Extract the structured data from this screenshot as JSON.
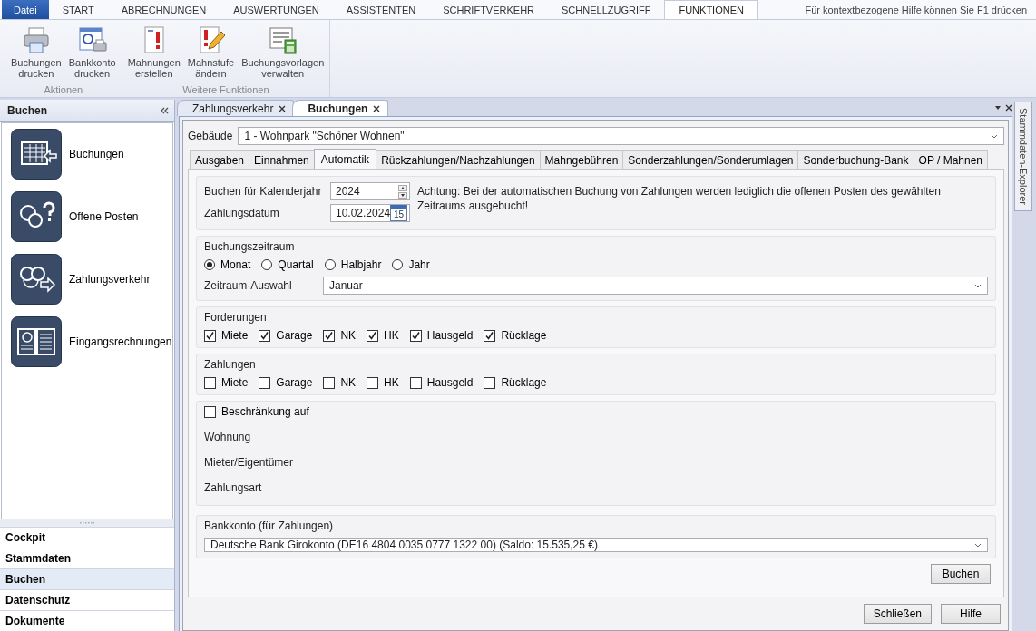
{
  "menu_tabs": [
    {
      "label": "Datei",
      "kind": "file"
    },
    {
      "label": "START",
      "kind": "tab",
      "selected": false
    },
    {
      "label": "ABRECHNUNGEN",
      "kind": "tab",
      "selected": false
    },
    {
      "label": "AUSWERTUNGEN",
      "kind": "tab",
      "selected": false
    },
    {
      "label": "ASSISTENTEN",
      "kind": "tab",
      "selected": false
    },
    {
      "label": "SCHRIFTVERKEHR",
      "kind": "tab",
      "selected": false
    },
    {
      "label": "SCHNELLZUGRIFF",
      "kind": "tab",
      "selected": false
    },
    {
      "label": "FUNKTIONEN",
      "kind": "tab",
      "selected": true
    }
  ],
  "help_hint": "Für kontextbezogene Hilfe können Sie F1 drücken",
  "ribbon_groups": [
    {
      "label": "Aktionen",
      "buttons": [
        {
          "label": "Buchungen\ndrucken"
        },
        {
          "label": "Bankkonto\ndrucken"
        }
      ]
    },
    {
      "label": "Weitere Funktionen",
      "buttons": [
        {
          "label": "Mahnungen\nerstellen"
        },
        {
          "label": "Mahnstufe\nändern"
        },
        {
          "label": "Buchungsvorlagen\nverwalten"
        }
      ]
    }
  ],
  "sidebar": {
    "title": "Buchen",
    "items": [
      {
        "label": "Buchungen"
      },
      {
        "label": "Offene Posten"
      },
      {
        "label": "Zahlungsverkehr"
      },
      {
        "label": "Eingangsrechnungen"
      }
    ],
    "nav": [
      {
        "label": "Cockpit",
        "selected": false
      },
      {
        "label": "Stammdaten",
        "selected": false
      },
      {
        "label": "Buchen",
        "selected": true
      },
      {
        "label": "Datenschutz",
        "selected": false
      },
      {
        "label": "Dokumente",
        "selected": false
      }
    ]
  },
  "document_tabs": [
    {
      "label": "Zahlungsverkehr",
      "selected": false
    },
    {
      "label": "Buchungen",
      "selected": true
    }
  ],
  "side_tab": "Stammdaten-Explorer",
  "form": {
    "building": {
      "label": "Gebäude",
      "value": "1 - Wohnpark \"Schöner Wohnen\""
    },
    "tabs": [
      {
        "label": "Ausgaben",
        "selected": false
      },
      {
        "label": "Einnahmen",
        "selected": false
      },
      {
        "label": "Automatik",
        "selected": true
      },
      {
        "label": "Rückzahlungen/Nachzahlungen",
        "selected": false
      },
      {
        "label": "Mahngebühren",
        "selected": false
      },
      {
        "label": "Sonderzahlungen/Sonderumlagen",
        "selected": false
      },
      {
        "label": "Sonderbuchung-Bank",
        "selected": false
      },
      {
        "label": "OP / Mahnen",
        "selected": false
      }
    ],
    "year": {
      "label": "Buchen für Kalenderjahr",
      "value": "2024"
    },
    "date": {
      "label": "Zahlungsdatum",
      "value": "10.02.2024",
      "calendar_label": "15"
    },
    "notice": "Achtung: Bei der automatischen Buchung von Zahlungen werden lediglich die offenen Posten des gewählten Zeitraums ausgebucht!",
    "period": {
      "title": "Buchungszeitraum",
      "options": [
        {
          "label": "Monat",
          "selected": true
        },
        {
          "label": "Quartal",
          "selected": false
        },
        {
          "label": "Halbjahr",
          "selected": false
        },
        {
          "label": "Jahr",
          "selected": false
        }
      ],
      "selection_label": "Zeitraum-Auswahl",
      "selection": "Januar"
    },
    "claims": {
      "title": "Forderungen",
      "items": [
        {
          "label": "Miete",
          "checked": true
        },
        {
          "label": "Garage",
          "checked": true
        },
        {
          "label": "NK",
          "checked": true
        },
        {
          "label": "HK",
          "checked": true
        },
        {
          "label": "Hausgeld",
          "checked": true
        },
        {
          "label": "Rücklage",
          "checked": true
        }
      ]
    },
    "payments": {
      "title": "Zahlungen",
      "items": [
        {
          "label": "Miete",
          "checked": false
        },
        {
          "label": "Garage",
          "checked": false
        },
        {
          "label": "NK",
          "checked": false
        },
        {
          "label": "HK",
          "checked": false
        },
        {
          "label": "Hausgeld",
          "checked": false
        },
        {
          "label": "Rücklage",
          "checked": false
        }
      ]
    },
    "restriction": {
      "label": "Beschränkung auf",
      "checked": false,
      "fields": [
        "Wohnung",
        "Mieter/Eigentümer",
        "Zahlungsart"
      ]
    },
    "bank": {
      "title": "Bankkonto (für Zahlungen)",
      "value": "Deutsche Bank Girokonto (DE16 4804 0035 0777 1322 00) (Saldo: 15.535,25 €)"
    },
    "submit": "Buchen"
  },
  "footer_buttons": [
    "Schließen",
    "Hilfe"
  ]
}
